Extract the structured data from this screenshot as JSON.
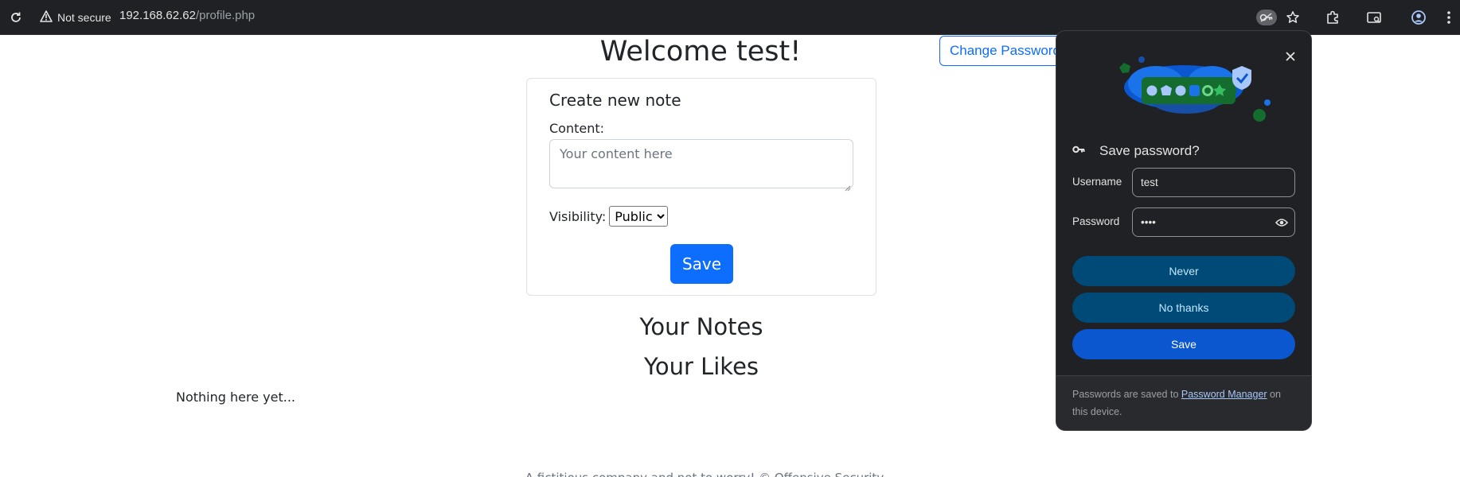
{
  "browser": {
    "security_label": "Not secure",
    "url_host": "192.168.62.62",
    "url_path": "/profile.php",
    "icons": [
      "reload-icon",
      "warning-icon",
      "password-key-icon",
      "bookmark-star-icon",
      "extensions-icon",
      "cast-icon",
      "profile-icon",
      "menu-icon"
    ]
  },
  "page": {
    "welcome": "Welcome test!",
    "change_password": "Change Password",
    "form": {
      "title": "Create new note",
      "content_label": "Content:",
      "content_placeholder": "Your content here",
      "content_value": "",
      "visibility_label": "Visibility:",
      "visibility_selected": "Public",
      "save_label": "Save"
    },
    "notes_heading": "Your Notes",
    "likes_heading": "Your Likes",
    "empty_text": "Nothing here yet...",
    "footer_partial": "A fictitious company and not to worry! © Offensive Security"
  },
  "password_bubble": {
    "title": "Save password?",
    "username_label": "Username",
    "username_value": "test",
    "password_label": "Password",
    "password_value": "••••",
    "never_label": "Never",
    "no_thanks_label": "No thanks",
    "save_label": "Save",
    "footer_prefix": "Passwords are saved to ",
    "footer_link": "Password Manager",
    "footer_suffix": " on this device.",
    "colors": {
      "background": "#202124",
      "tonal_button": "#004a77",
      "primary_button": "#0b57d0",
      "link": "#a8c7fa"
    }
  },
  "colors": {
    "primary": "#0d6efd",
    "text": "#212529",
    "muted": "#6c757d"
  }
}
